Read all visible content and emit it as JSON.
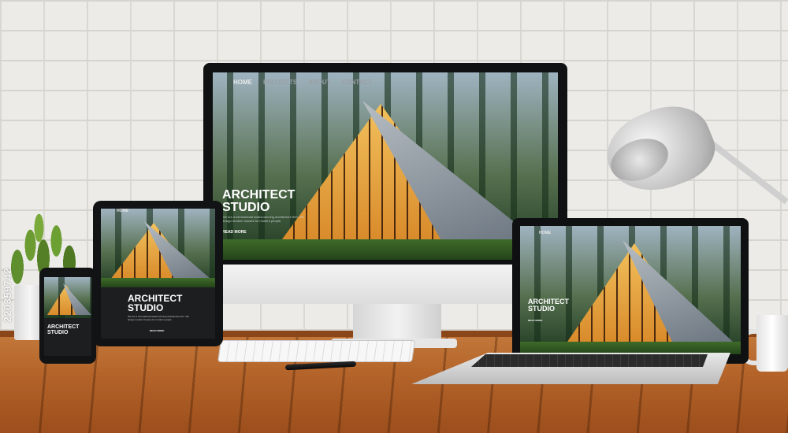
{
  "website": {
    "nav": [
      "HOME",
      "PROJECTS",
      "ABOUT",
      "CONTACT"
    ],
    "title": "ARCHITECT\nSTUDIO",
    "description": "We are a international award-winning architecture firm. We design modern houses for modern people.",
    "cta": "READ MORE"
  },
  "watermark": "220359742",
  "icons": {
    "lamp": "desk-lamp",
    "plant": "potted-plant",
    "mug": "coffee-mug",
    "pen": "pen"
  }
}
